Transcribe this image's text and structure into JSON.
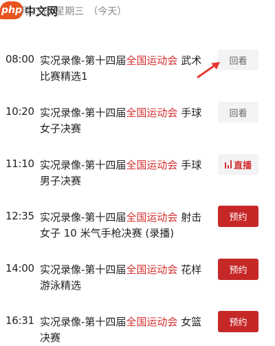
{
  "watermark": {
    "logo": "php",
    "text": "中文网"
  },
  "header": {
    "date": "月15日 星期三",
    "today": "（今天）"
  },
  "programs": [
    {
      "time": "08:00",
      "prefix": "实况录像-第十四届",
      "highlight": "全国运动会",
      "suffix": " 武术比赛精选1",
      "button": "回看",
      "button_type": "replay"
    },
    {
      "time": "10:20",
      "prefix": "实况录像-第十四届",
      "highlight": "全国运动会",
      "suffix": " 手球女子决赛",
      "button": "回看",
      "button_type": "replay"
    },
    {
      "time": "11:10",
      "prefix": "实况录像-第十四届",
      "highlight": "全国运动会",
      "suffix": " 手球男子决赛",
      "button": "直播",
      "button_type": "live"
    },
    {
      "time": "12:35",
      "prefix": "实况录像-第十四届",
      "highlight": "全国运动会",
      "suffix": " 射击女子 10 米气手枪决赛 (录播)",
      "button": "预约",
      "button_type": "reserve"
    },
    {
      "time": "14:00",
      "prefix": "实况录像-第十四届",
      "highlight": "全国运动会",
      "suffix": " 花样游泳精选",
      "button": "预约",
      "button_type": "reserve"
    },
    {
      "time": "16:31",
      "prefix": "实况录像-第十四届",
      "highlight": "全国运动会",
      "suffix": " 女篮决赛",
      "button": "预约",
      "button_type": "reserve"
    }
  ],
  "colors": {
    "accent": "#c62828",
    "highlight": "#d32f2f",
    "replay_bg": "#f2f3f5"
  },
  "icons": {
    "live": "live-bars-icon",
    "annotation": "red-arrow-icon"
  }
}
